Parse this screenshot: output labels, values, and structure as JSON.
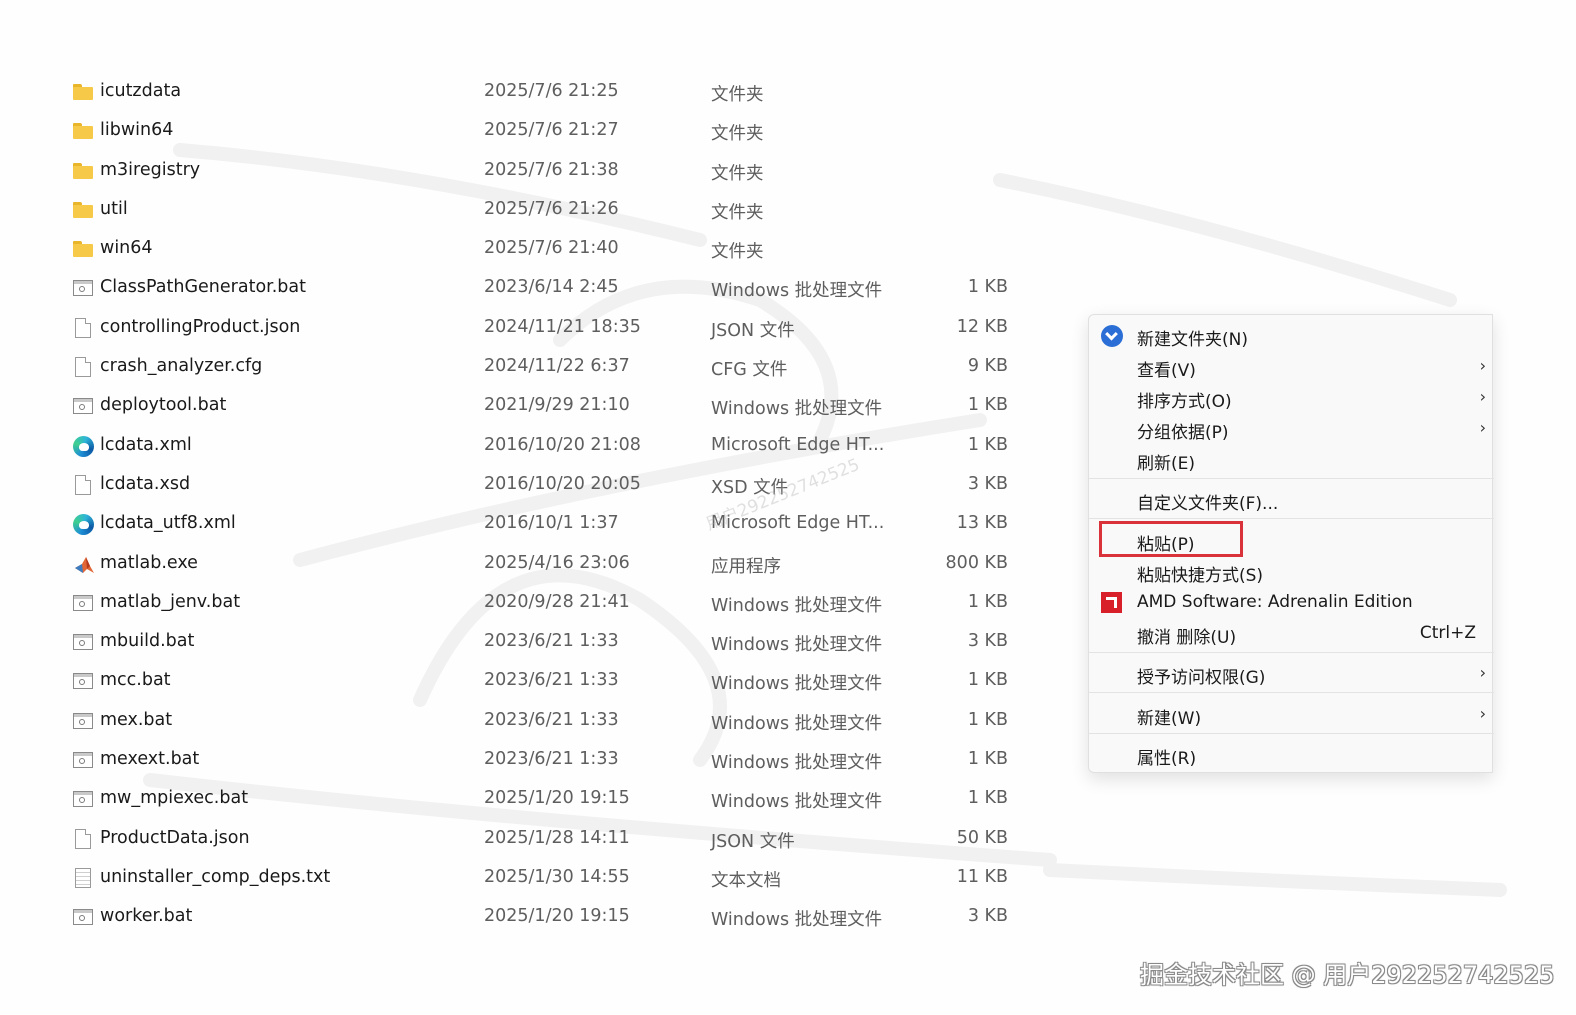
{
  "files": [
    {
      "icon": "folder-icon",
      "name": "icutzdata",
      "date": "2025/7/6 21:25",
      "type": "文件夹",
      "size": ""
    },
    {
      "icon": "folder-icon",
      "name": "libwin64",
      "date": "2025/7/6 21:27",
      "type": "文件夹",
      "size": ""
    },
    {
      "icon": "folder-icon",
      "name": "m3iregistry",
      "date": "2025/7/6 21:38",
      "type": "文件夹",
      "size": ""
    },
    {
      "icon": "folder-icon",
      "name": "util",
      "date": "2025/7/6 21:26",
      "type": "文件夹",
      "size": ""
    },
    {
      "icon": "folder-icon",
      "name": "win64",
      "date": "2025/7/6 21:40",
      "type": "文件夹",
      "size": ""
    },
    {
      "icon": "batch-file-icon",
      "name": "ClassPathGenerator.bat",
      "date": "2023/6/14 2:45",
      "type": "Windows 批处理文件",
      "size": "1 KB"
    },
    {
      "icon": "document-icon",
      "name": "controllingProduct.json",
      "date": "2024/11/21 18:35",
      "type": "JSON 文件",
      "size": "12 KB"
    },
    {
      "icon": "document-icon",
      "name": "crash_analyzer.cfg",
      "date": "2024/11/22 6:37",
      "type": "CFG 文件",
      "size": "9 KB"
    },
    {
      "icon": "batch-file-icon",
      "name": "deploytool.bat",
      "date": "2021/9/29 21:10",
      "type": "Windows 批处理文件",
      "size": "1 KB"
    },
    {
      "icon": "edge-icon",
      "name": "lcdata.xml",
      "date": "2016/10/20 21:08",
      "type": "Microsoft Edge HT...",
      "size": "1 KB"
    },
    {
      "icon": "document-icon",
      "name": "lcdata.xsd",
      "date": "2016/10/20 20:05",
      "type": "XSD 文件",
      "size": "3 KB"
    },
    {
      "icon": "edge-icon",
      "name": "lcdata_utf8.xml",
      "date": "2016/10/1 1:37",
      "type": "Microsoft Edge HT...",
      "size": "13 KB"
    },
    {
      "icon": "matlab-icon",
      "name": "matlab.exe",
      "date": "2025/4/16 23:06",
      "type": "应用程序",
      "size": "800 KB"
    },
    {
      "icon": "batch-file-icon",
      "name": "matlab_jenv.bat",
      "date": "2020/9/28 21:41",
      "type": "Windows 批处理文件",
      "size": "1 KB"
    },
    {
      "icon": "batch-file-icon",
      "name": "mbuild.bat",
      "date": "2023/6/21 1:33",
      "type": "Windows 批处理文件",
      "size": "3 KB"
    },
    {
      "icon": "batch-file-icon",
      "name": "mcc.bat",
      "date": "2023/6/21 1:33",
      "type": "Windows 批处理文件",
      "size": "1 KB"
    },
    {
      "icon": "batch-file-icon",
      "name": "mex.bat",
      "date": "2023/6/21 1:33",
      "type": "Windows 批处理文件",
      "size": "1 KB"
    },
    {
      "icon": "batch-file-icon",
      "name": "mexext.bat",
      "date": "2023/6/21 1:33",
      "type": "Windows 批处理文件",
      "size": "1 KB"
    },
    {
      "icon": "batch-file-icon",
      "name": "mw_mpiexec.bat",
      "date": "2025/1/20 19:15",
      "type": "Windows 批处理文件",
      "size": "1 KB"
    },
    {
      "icon": "document-icon",
      "name": "ProductData.json",
      "date": "2025/1/28 14:11",
      "type": "JSON 文件",
      "size": "50 KB"
    },
    {
      "icon": "text-file-icon",
      "name": "uninstaller_comp_deps.txt",
      "date": "2025/1/30 14:55",
      "type": "文本文档",
      "size": "11 KB"
    },
    {
      "icon": "batch-file-icon",
      "name": "worker.bat",
      "date": "2025/1/20 19:15",
      "type": "Windows 批处理文件",
      "size": "3 KB"
    }
  ],
  "context_menu": {
    "new_folder": "新建文件夹(N)",
    "view": "查看(V)",
    "sort_by": "排序方式(O)",
    "group_by": "分组依据(P)",
    "refresh": "刷新(E)",
    "customize_folder": "自定义文件夹(F)...",
    "paste": "粘贴(P)",
    "paste_shortcut": "粘贴快捷方式(S)",
    "amd_software": "AMD Software: Adrenalin Edition",
    "undo_delete": "撤消 删除(U)",
    "undo_shortcut": "Ctrl+Z",
    "give_access": "授予访问权限(G)",
    "new": "新建(W)",
    "properties": "属性(R)",
    "submenu_chevron": "›"
  },
  "watermark": {
    "text": "掘金技术社区 @ 用户292252742525",
    "faint_text": "用户292252742525"
  },
  "colors": {
    "highlight_box": "#d9323a",
    "folder": "#f7c948",
    "amd_red": "#d8202a",
    "new_folder_blue": "#2b6fd6"
  }
}
